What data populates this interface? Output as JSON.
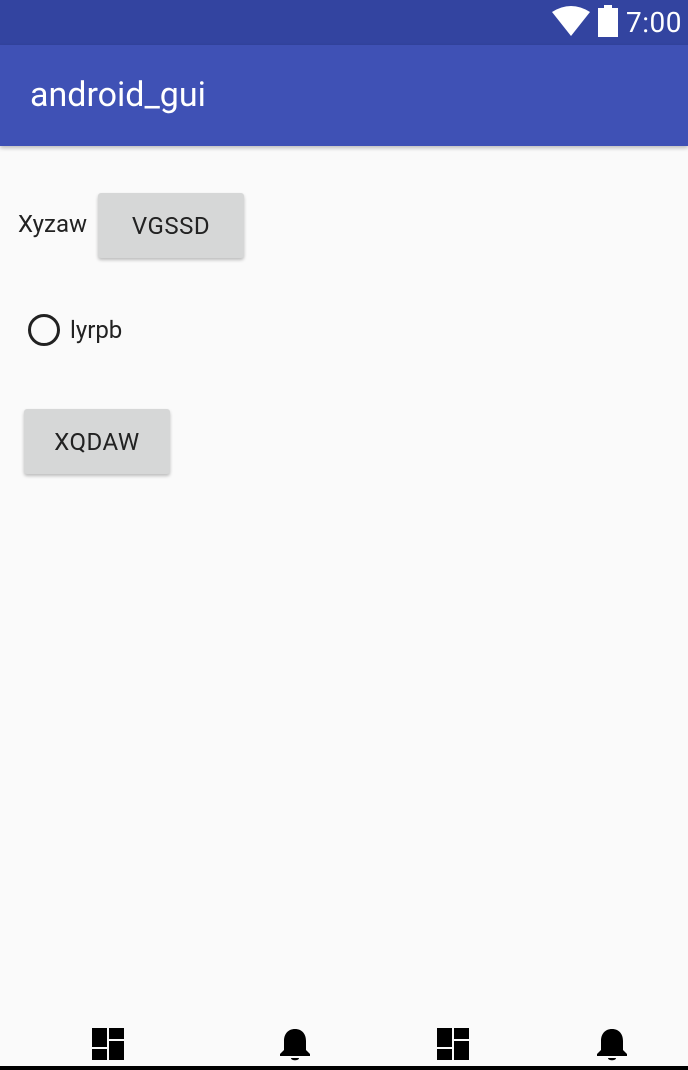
{
  "status_bar": {
    "time": "7:00",
    "icons": [
      "wifi-icon",
      "battery-icon"
    ]
  },
  "app_bar": {
    "title": "android_gui"
  },
  "main": {
    "label_text": "Xyzaw",
    "button_1_label": "VGSSD",
    "radio_label": "lyrpb",
    "radio_checked": false,
    "button_2_label": "XQDAW"
  },
  "bottom_nav": {
    "items": [
      "dashboard-icon",
      "notifications-icon",
      "dashboard-icon",
      "notifications-icon"
    ]
  },
  "colors": {
    "status_bar": "#3344a0",
    "app_bar": "#3f51b5",
    "background": "#fafafa",
    "button": "#d6d7d7"
  }
}
